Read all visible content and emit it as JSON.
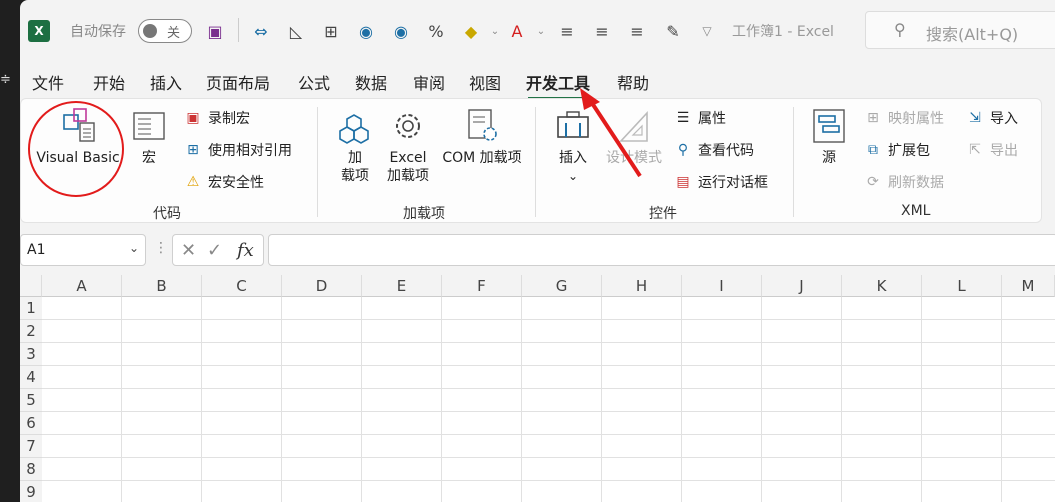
{
  "quick_access": {
    "app_icon": "excel-logo",
    "autosave_label": "自动保存",
    "autosave_state": "关",
    "doc_title": "工作簿1  -  Excel",
    "search_placeholder": "搜索(Alt+Q)"
  },
  "menu": {
    "tabs": [
      "文件",
      "开始",
      "插入",
      "页面布局",
      "公式",
      "数据",
      "审阅",
      "视图",
      "开发工具",
      "帮助"
    ],
    "active": "开发工具"
  },
  "ribbon": {
    "groups": {
      "code": "代码",
      "addins": "加载项",
      "controls": "控件",
      "xml": "XML"
    },
    "code": {
      "visual_basic": "Visual Basic",
      "macros": "宏",
      "record_macro": "录制宏",
      "relative_refs": "使用相对引用",
      "macro_security": "宏安全性"
    },
    "addins": {
      "addins_line1": "加",
      "addins_line2": "载项",
      "excel_addins_line1": "Excel",
      "excel_addins_line2": "加载项",
      "com_addins": "COM 加载项"
    },
    "controls": {
      "insert": "插入",
      "design_mode": "设计模式",
      "properties": "属性",
      "view_code": "查看代码",
      "run_dialog": "运行对话框"
    },
    "xml": {
      "source": "源",
      "map_properties": "映射属性",
      "expansion_packs": "扩展包",
      "refresh_data": "刷新数据",
      "import": "导入",
      "export": "导出"
    }
  },
  "formula_bar": {
    "name_box": "A1",
    "fx": "fx",
    "content": ""
  },
  "sheet": {
    "columns": [
      "A",
      "B",
      "C",
      "D",
      "E",
      "F",
      "G",
      "H",
      "I",
      "J",
      "K",
      "L",
      "M"
    ],
    "rows": [
      "1",
      "2",
      "3",
      "4",
      "5",
      "6",
      "7",
      "8",
      "9"
    ]
  },
  "colors": {
    "accent": "#217346",
    "annotation": "#e21b1b"
  }
}
